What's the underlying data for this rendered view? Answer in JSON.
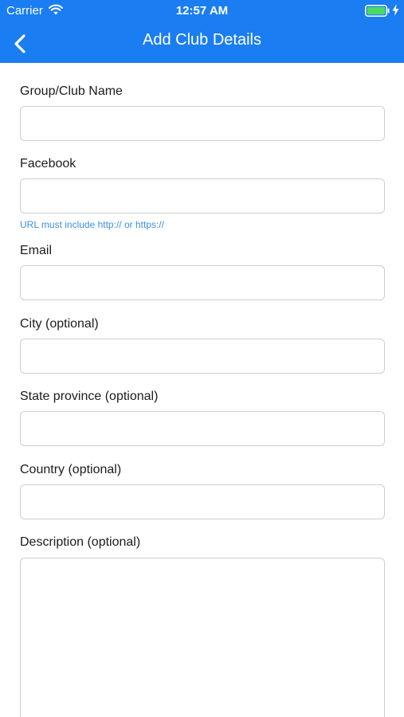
{
  "status_bar": {
    "carrier": "Carrier",
    "time": "12:57 AM",
    "icons": [
      "wifi-icon",
      "battery-icon",
      "charging-icon"
    ]
  },
  "nav": {
    "title": "Add Club Details",
    "back_icon": "chevron-left-icon"
  },
  "form": {
    "group_name": {
      "label": "Group/Club Name",
      "value": ""
    },
    "facebook": {
      "label": "Facebook",
      "value": "",
      "hint": "URL must include http:// or https://"
    },
    "email": {
      "label": "Email",
      "value": ""
    },
    "city": {
      "label": "City (optional)",
      "value": ""
    },
    "state": {
      "label": "State province (optional)",
      "value": ""
    },
    "country": {
      "label": "Country (optional)",
      "value": ""
    },
    "description": {
      "label": "Description (optional)",
      "value": ""
    }
  },
  "colors": {
    "accent": "#1a7df1",
    "hint": "#3b8fe6",
    "battery": "#4cd964",
    "input_border": "#cfcfcf"
  }
}
